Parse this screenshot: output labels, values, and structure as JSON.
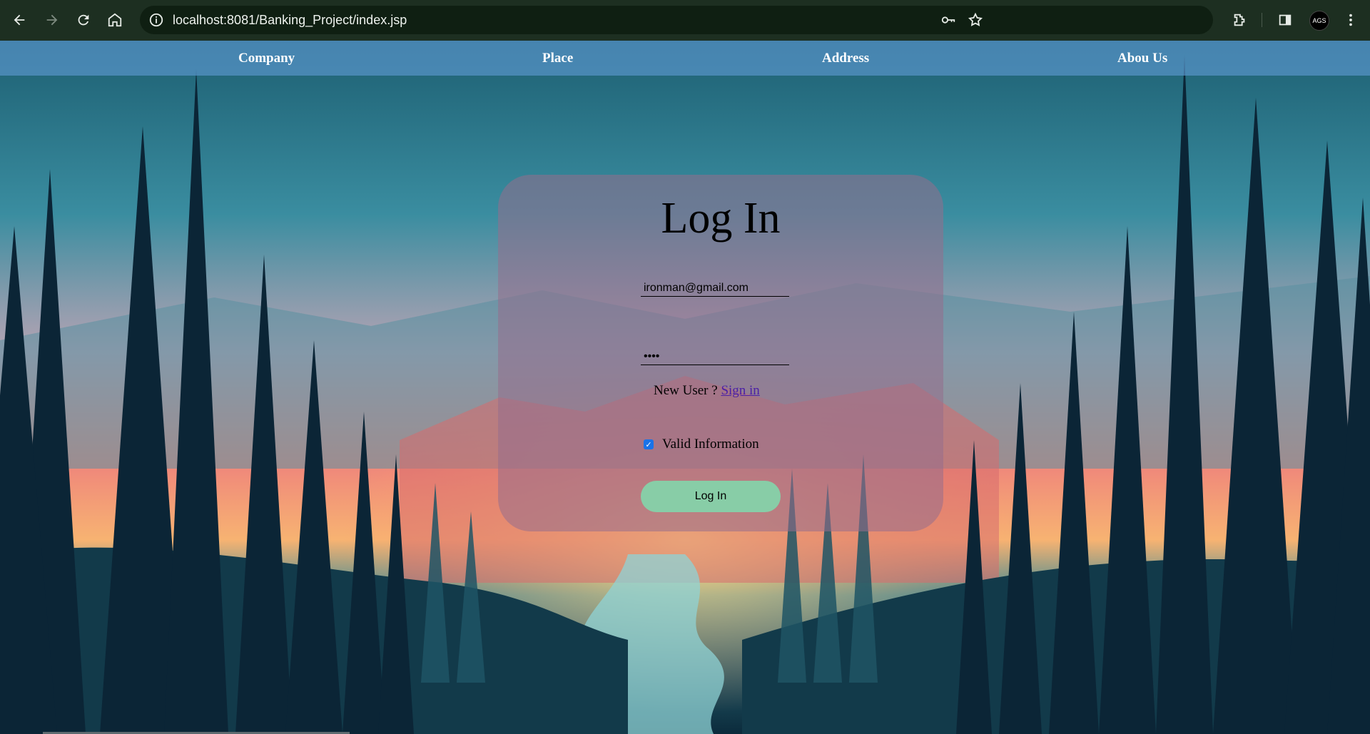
{
  "browser": {
    "url": "localhost:8081/Banking_Project/index.jsp",
    "profile_initials": "AGS",
    "icons": [
      "back-arrow-icon",
      "forward-arrow-icon",
      "reload-icon",
      "home-icon",
      "site-info-icon",
      "key-icon",
      "star-icon",
      "extensions-icon",
      "side-panel-icon",
      "more-icon"
    ]
  },
  "nav": {
    "items": [
      {
        "label": "Company"
      },
      {
        "label": "Place"
      },
      {
        "label": "Address"
      },
      {
        "label": "Abou Us"
      }
    ]
  },
  "login": {
    "title": "Log In",
    "email_value": "ironman@gmail.com",
    "password_value": "••••",
    "new_user_text": "New User ?",
    "sign_in_link": "Sign in",
    "checkbox_label": "Valid Information",
    "checkbox_checked": true,
    "submit_label": "Log In"
  },
  "colors": {
    "nav_bar": "#5a96cd",
    "card": "#966e8c",
    "button": "#88cda7",
    "link": "#4b1fa6"
  }
}
